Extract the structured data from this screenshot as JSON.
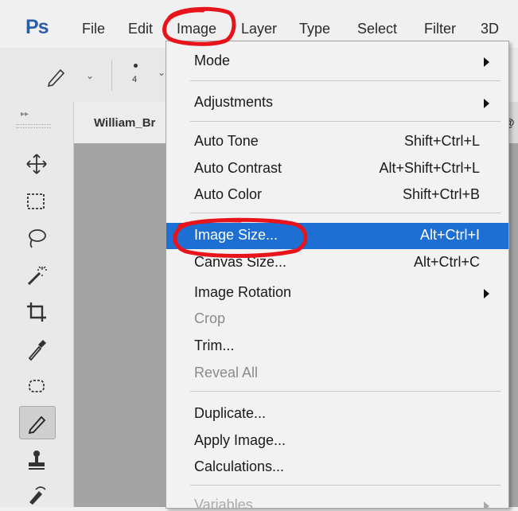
{
  "menubar": {
    "logo": "Ps",
    "items": [
      "File",
      "Edit",
      "Image",
      "Layer",
      "Type",
      "Select",
      "Filter",
      "3D"
    ]
  },
  "options_bar": {
    "brush_size": "4"
  },
  "document": {
    "tab_title": "William_Br",
    "tab_suffix": "@"
  },
  "toolbox": {
    "tools": [
      "move-icon",
      "marquee-icon",
      "lasso-icon",
      "magic-wand-icon",
      "crop-icon",
      "eyedropper-icon",
      "patch-icon",
      "pencil-icon",
      "stamp-icon",
      "history-brush-icon"
    ],
    "active": "pencil-icon"
  },
  "image_menu": {
    "items": [
      {
        "label": "Mode",
        "shortcut": "",
        "submenu": true,
        "enabled": true
      },
      {
        "label": "Adjustments",
        "shortcut": "",
        "submenu": true,
        "enabled": true
      },
      {
        "label": "Auto Tone",
        "shortcut": "Shift+Ctrl+L",
        "enabled": true
      },
      {
        "label": "Auto Contrast",
        "shortcut": "Alt+Shift+Ctrl+L",
        "enabled": true
      },
      {
        "label": "Auto Color",
        "shortcut": "Shift+Ctrl+B",
        "enabled": true
      },
      {
        "label": "Image Size...",
        "shortcut": "Alt+Ctrl+I",
        "enabled": true,
        "highlighted": true
      },
      {
        "label": "Canvas Size...",
        "shortcut": "Alt+Ctrl+C",
        "enabled": true
      },
      {
        "label": "Image Rotation",
        "shortcut": "",
        "submenu": true,
        "enabled": true
      },
      {
        "label": "Crop",
        "shortcut": "",
        "enabled": false
      },
      {
        "label": "Trim...",
        "shortcut": "",
        "enabled": true
      },
      {
        "label": "Reveal All",
        "shortcut": "",
        "enabled": false
      },
      {
        "label": "Duplicate...",
        "shortcut": "",
        "enabled": true
      },
      {
        "label": "Apply Image...",
        "shortcut": "",
        "enabled": true
      },
      {
        "label": "Calculations...",
        "shortcut": "",
        "enabled": true
      },
      {
        "label": "Variables",
        "shortcut": "",
        "submenu": true,
        "enabled": true
      }
    ]
  },
  "colors": {
    "highlight": "#1e6fd3",
    "annotation": "#e8141b",
    "logo": "#2c5ea8"
  }
}
